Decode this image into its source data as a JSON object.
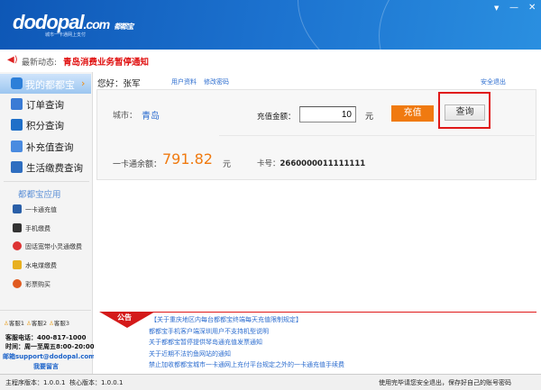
{
  "header": {
    "logo": "dodopal",
    "logo_suffix": ".com",
    "logo_cn": "都都宝",
    "slogan": "城市一卡通网上支付",
    "controls": [
      "▼",
      "—",
      "✕"
    ]
  },
  "notice": {
    "label": "最新动态:",
    "text": "青岛消费业务暂停通知"
  },
  "sidebar": {
    "title": "我的都都宝",
    "menu": [
      {
        "label": "订单查询",
        "color": "#3a7bd5"
      },
      {
        "label": "积分查询",
        "color": "#1f6fc8"
      },
      {
        "label": "补充值查询",
        "color": "#4a8be0"
      },
      {
        "label": "生活缴费查询",
        "color": "#2f6ec0"
      }
    ],
    "apps_title": "都都宝应用",
    "apps": [
      {
        "label": "一卡通充值",
        "color": "#2a5fa8"
      },
      {
        "label": "手机缴费",
        "color": "#333"
      },
      {
        "label": "固话宽带小灵通缴费",
        "color": "#d33"
      },
      {
        "label": "水电煤缴费",
        "color": "#e8b020"
      },
      {
        "label": "彩票购买",
        "color": "#e05a20"
      }
    ],
    "service": [
      "客服1",
      "客服2",
      "客服3"
    ],
    "phone": "客服电话：400-817-1000",
    "hours": "时间：周一至周五8:00-20:00",
    "email": "邮箱support@dodopal.com",
    "leave_msg": "我要留言"
  },
  "main": {
    "greeting": "您好：张军",
    "links": [
      "用户资料",
      "修改密码"
    ],
    "logout": "安全退出",
    "city_label": "城市：",
    "city": "青岛",
    "amount_label": "充值金额：",
    "amount": "10",
    "unit": "元",
    "recharge": "充值",
    "query": "查询",
    "balance_label": "一卡通余额：",
    "balance": "791.82",
    "balance_unit": "元",
    "card_label": "卡号：",
    "card": "2660000011111111"
  },
  "announce": {
    "tag": "公告",
    "items": [
      "【关于重庆地区内每台都都宝终端每天充值限制规定】",
      "都都宝手机客户端深圳用户不支持机型说明",
      "关于都都宝暂停提供琴岛通充值发票通知",
      "关于近期不法钓鱼网站的通知",
      "禁止加收都都宝城市一卡通网上充付平台规定之外的一卡通充值手续费"
    ]
  },
  "status": {
    "version": "主程序版本：1.0.0.1  核心版本：1.0.0.1",
    "tip": "使用完毕请您安全退出，保存好自己的账号密码"
  }
}
